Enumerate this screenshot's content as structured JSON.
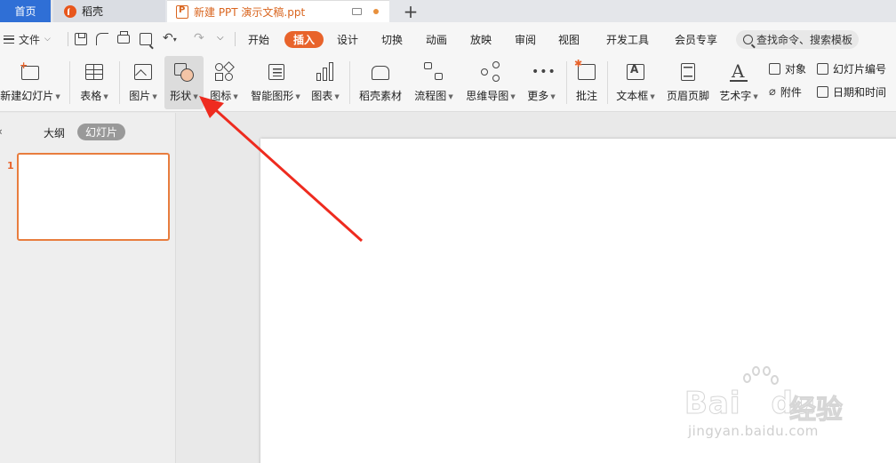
{
  "tabs": {
    "home": "首页",
    "daoke": "稻壳",
    "document": "新建 PPT 演示文稿.ppt",
    "new_tab": "+"
  },
  "menu": {
    "file": "文件",
    "tabs": [
      "开始",
      "插入",
      "设计",
      "切换",
      "动画",
      "放映",
      "审阅",
      "视图",
      "开发工具",
      "会员专享"
    ],
    "active_tab": "插入",
    "search": "查找命令、搜索模板"
  },
  "ribbon": {
    "new_slide": "新建幻灯片",
    "table": "表格",
    "picture": "图片",
    "shape": "形状",
    "icons": "图标",
    "smart_art": "智能图形",
    "chart": "图表",
    "daoke_material": "稻壳素材",
    "flowchart": "流程图",
    "mindmap": "思维导图",
    "more": "更多",
    "comment": "批注",
    "textbox": "文本框",
    "header_footer": "页眉页脚",
    "wordart": "艺术字",
    "object": "对象",
    "slide_number": "幻灯片编号",
    "attachment": "附件",
    "date_time": "日期和时间"
  },
  "left_panel": {
    "close": "‹",
    "outline": "大纲",
    "slides": "幻灯片",
    "thumb_number": "1"
  },
  "watermark": {
    "brand": "Bai",
    "brand_tail": "du",
    "cn": "经验",
    "url": "jingyan.baidu.com"
  },
  "colors": {
    "accent": "#e8632b",
    "home_tab": "#2f6fd6",
    "annotation_arrow": "#ee2b1f"
  }
}
